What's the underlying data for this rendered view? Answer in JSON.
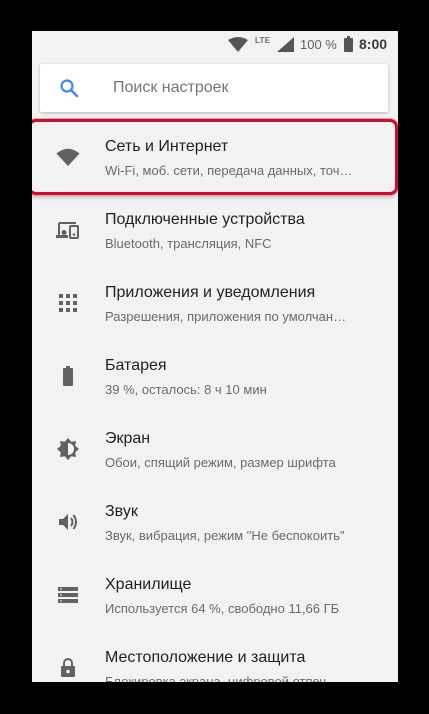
{
  "status_bar": {
    "network_type": "LTE",
    "battery_percent": "100 %",
    "time": "8:00"
  },
  "search": {
    "placeholder": "Поиск настроек"
  },
  "settings": [
    {
      "title": "Сеть и Интернет",
      "subtitle": "Wi-Fi, моб. сети, передача данных, точ…",
      "icon": "wifi-icon"
    },
    {
      "title": "Подключенные устройства",
      "subtitle": "Bluetooth, трансляция, NFC",
      "icon": "devices-icon"
    },
    {
      "title": "Приложения и уведомления",
      "subtitle": "Разрешения, приложения по умолчан…",
      "icon": "apps-icon"
    },
    {
      "title": "Батарея",
      "subtitle": "39 %, осталось: 8 ч 10 мин",
      "icon": "battery-icon"
    },
    {
      "title": "Экран",
      "subtitle": "Обои, спящий режим, размер шрифта",
      "icon": "brightness-icon"
    },
    {
      "title": "Звук",
      "subtitle": "Звук, вибрация, режим \"Не беспокоить\"",
      "icon": "volume-icon"
    },
    {
      "title": "Хранилище",
      "subtitle": "Используется 64 %, свободно 11,66 ГБ",
      "icon": "storage-icon"
    },
    {
      "title": "Местоположение и защита",
      "subtitle": "Блокировка экрана, цифровой отпеч…",
      "icon": "lock-icon"
    }
  ],
  "colors": {
    "icon": "#616161",
    "accent": "#4285f4",
    "highlight_border": "#c8102e"
  }
}
